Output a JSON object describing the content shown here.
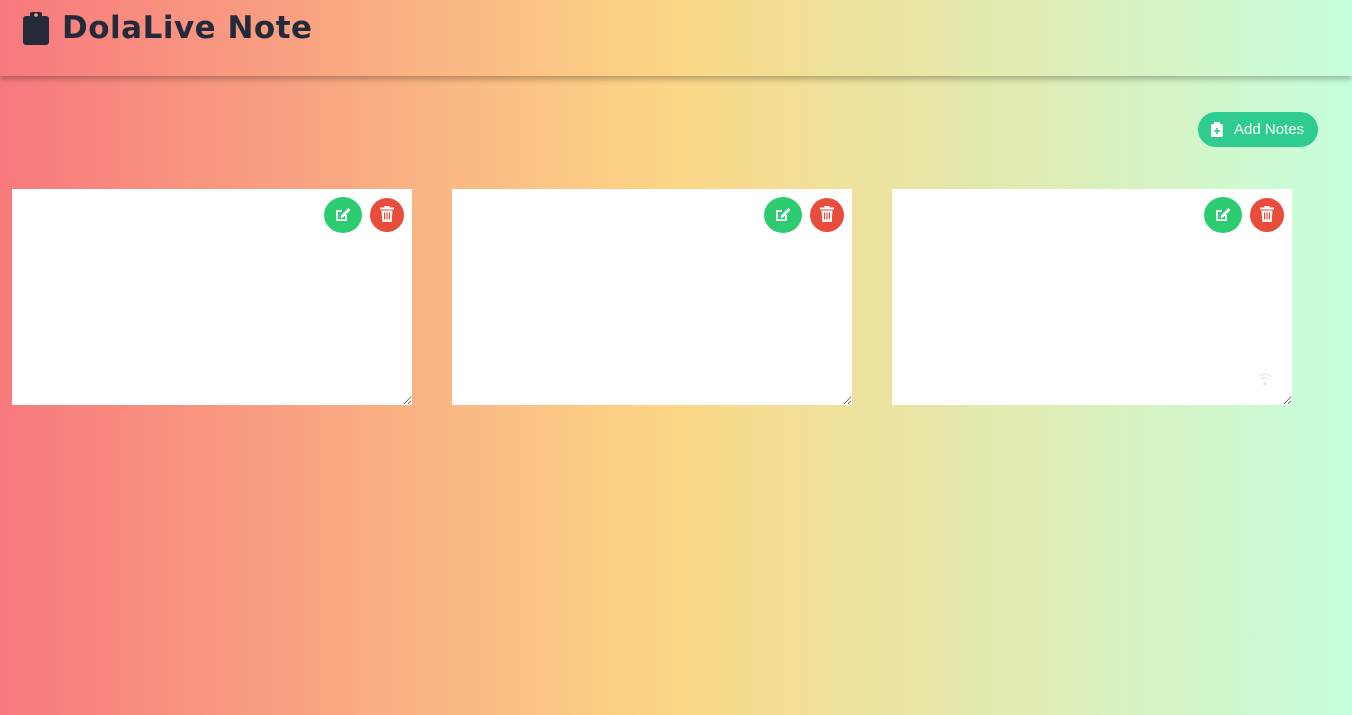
{
  "header": {
    "title": "DolaLive Note",
    "icon": "clipboard-icon"
  },
  "toolbar": {
    "add_label": "Add Notes",
    "add_icon": "clipboard-plus-icon"
  },
  "notes": [
    {
      "content": "",
      "edit_icon": "edit-icon",
      "delete_icon": "trash-icon"
    },
    {
      "content": "",
      "edit_icon": "edit-icon",
      "delete_icon": "trash-icon"
    },
    {
      "content": "",
      "edit_icon": "edit-icon",
      "delete_icon": "trash-icon"
    }
  ],
  "colors": {
    "gradient_start": "#f7797d",
    "gradient_mid": "#fbd786",
    "gradient_end": "#c6ffdd",
    "title": "#252a3a",
    "add_button": "#2ecc8f",
    "edit_button": "#2ecc71",
    "delete_button": "#e74c3c"
  }
}
